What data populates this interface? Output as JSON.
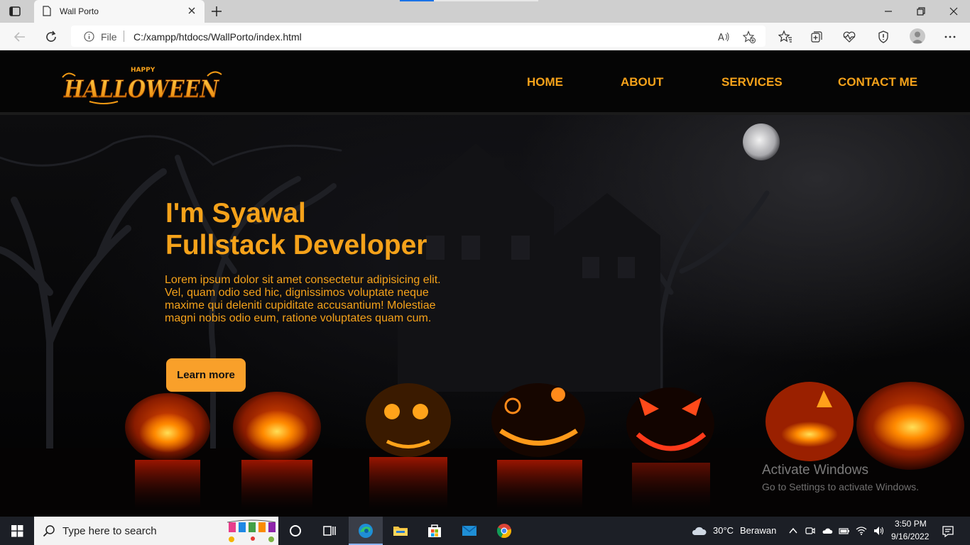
{
  "browser": {
    "tab_title": "Wall Porto",
    "url_scheme_label": "File",
    "url": "C:/xampp/htdocs/WallPorto/index.html"
  },
  "site": {
    "logo_text_top": "HAPPY",
    "logo_text": "HALLOWEEN",
    "nav": [
      "HOME",
      "ABOUT",
      "SERVICES",
      "CONTACT ME"
    ],
    "headline_line1": "I'm Syawal",
    "headline_line2": "Fullstack Developer",
    "body": "Lorem ipsum dolor sit amet consectetur adipisicing elit. Vel, quam odio sed hic, dignissimos voluptate neque maxime qui deleniti cupiditate accusantium! Molestiae magni nobis odio eum, ratione voluptates quam cum.",
    "cta_label": "Learn more",
    "accent_color": "#f5a21a"
  },
  "watermark": {
    "title": "Activate Windows",
    "subtitle": "Go to Settings to activate Windows."
  },
  "taskbar": {
    "search_placeholder": "Type here to search",
    "weather_temp": "30°C",
    "weather_desc": "Berawan",
    "time": "3:50 PM",
    "date": "9/16/2022",
    "apps": [
      "task-view",
      "edge",
      "file-explorer",
      "microsoft-store",
      "mail",
      "chrome"
    ]
  }
}
